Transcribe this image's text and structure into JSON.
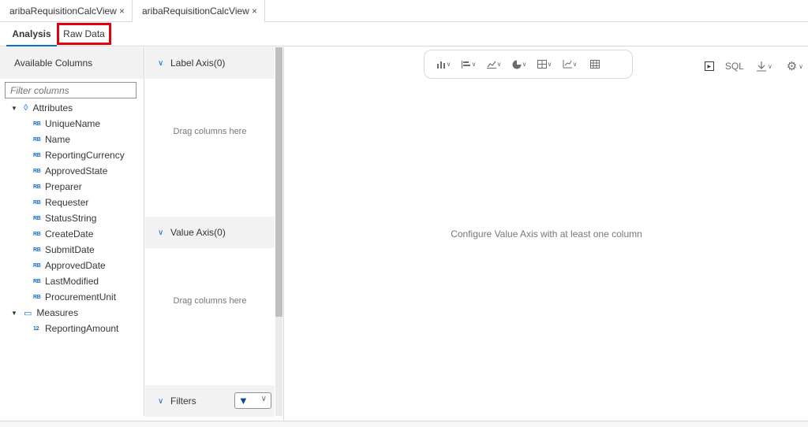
{
  "editor_tabs": [
    {
      "label": "aribaRequisitionCalcView",
      "close": "×"
    },
    {
      "label": "aribaRequisitionCalcView",
      "close": "×"
    }
  ],
  "view_tabs": {
    "analysis": "Analysis",
    "raw_data": "Raw Data"
  },
  "columns_panel": {
    "title": "Available Columns",
    "filter_placeholder": "Filter columns",
    "attributes_label": "Attributes",
    "attribute_type_icon": "RB",
    "attributes": [
      "UniqueName",
      "Name",
      "ReportingCurrency",
      "ApprovedState",
      "Preparer",
      "Requester",
      "StatusString",
      "CreateDate",
      "SubmitDate",
      "ApprovedDate",
      "LastModified",
      "ProcurementUnit"
    ],
    "measures_label": "Measures",
    "measure_type_icon": "12",
    "measures": [
      "ReportingAmount"
    ]
  },
  "axis_panel": {
    "label_axis": "Label Axis(0)",
    "label_hint": "Drag columns here",
    "value_axis": "Value Axis(0)",
    "value_hint": "Drag columns here",
    "filters": "Filters"
  },
  "chart": {
    "sql_label": "SQL",
    "empty_message": "Configure Value Axis with at least one column"
  },
  "colors": {
    "accent": "#0a6ed1",
    "highlight": "#e3000f"
  }
}
